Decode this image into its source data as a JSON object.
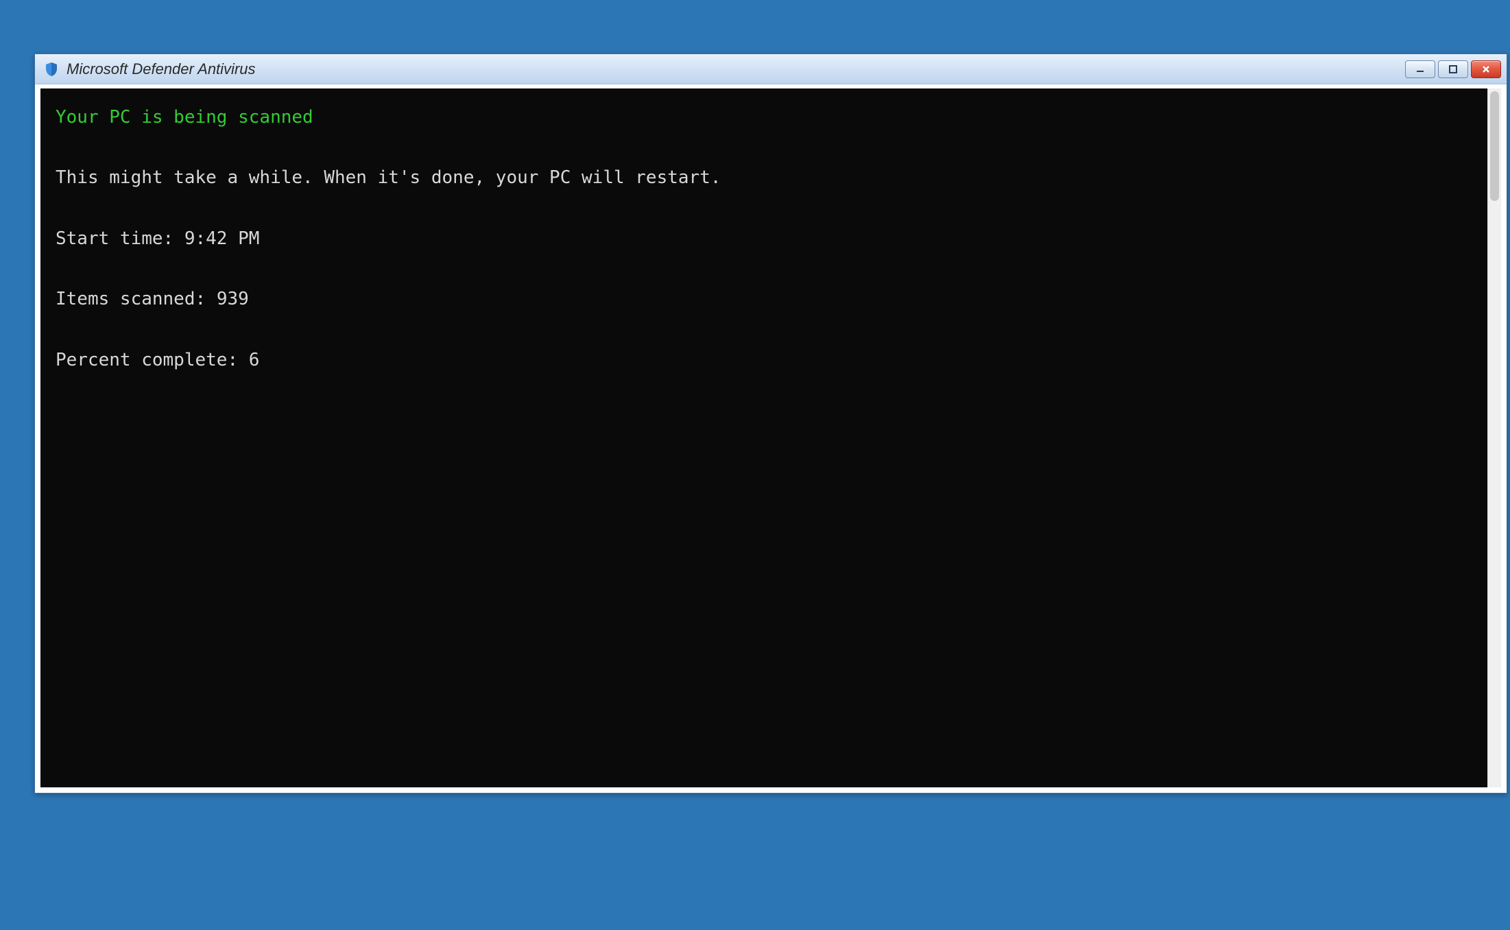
{
  "window": {
    "title": "Microsoft Defender Antivirus"
  },
  "console": {
    "heading": "Your PC is being scanned",
    "message": "This might take a while. When it's done, your PC will restart.",
    "start_time_label": "Start time:",
    "start_time_value": "9:42 PM",
    "items_scanned_label": "Items scanned:",
    "items_scanned_value": "939",
    "percent_label": "Percent complete:",
    "percent_value": "6"
  }
}
